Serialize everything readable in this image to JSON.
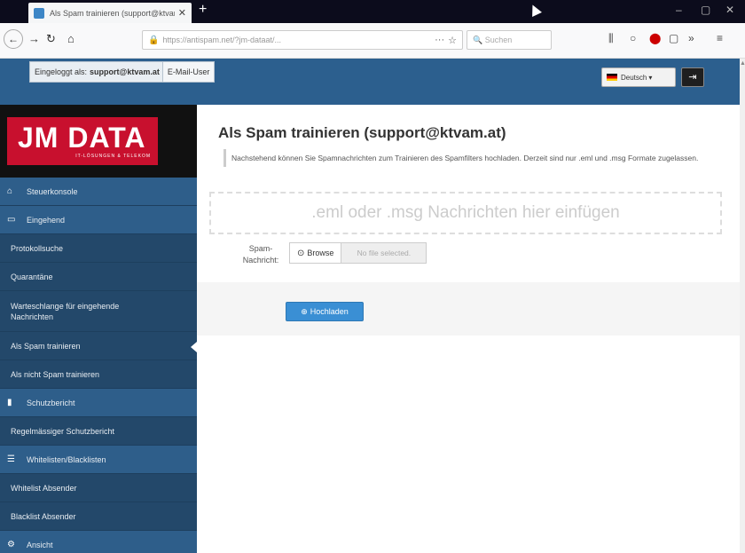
{
  "browser": {
    "tab_title": "Als Spam trainieren (support@ktvam.at)",
    "url": "https://antispam.net/?jm-dataat/...",
    "search_placeholder": "Suchen"
  },
  "header": {
    "login_label": "Eingeloggt als:",
    "login_user": "support@ktvam.at",
    "login_type": "E-Mail-User",
    "language": "Deutsch",
    "language_caret": "▾"
  },
  "logo": {
    "text": "JM DATA",
    "subtitle": "IT-LÖSUNGEN & TELEKOM"
  },
  "sidebar": {
    "items": [
      {
        "label": "Steuerkonsole",
        "icon": "home-icon"
      },
      {
        "label": "Eingehend",
        "icon": "inbox-icon"
      },
      {
        "label": "Protokollsuche"
      },
      {
        "label": "Quarantäne"
      },
      {
        "label": "Warteschlange für eingehende Nachrichten"
      },
      {
        "label": "Als Spam trainieren"
      },
      {
        "label": "Als nicht Spam trainieren"
      },
      {
        "label": "Schutzbericht",
        "icon": "file-icon"
      },
      {
        "label": "Regelmässiger Schutzbericht"
      },
      {
        "label": "Whitelisten/Blacklisten",
        "icon": "list-icon"
      },
      {
        "label": "Whitelist Absender"
      },
      {
        "label": "Blacklist Absender"
      },
      {
        "label": "Ansicht",
        "icon": "gear-icon"
      }
    ]
  },
  "main": {
    "title": "Als Spam trainieren (support@ktvam.at)",
    "info": "Nachstehend können Sie Spamnachrichten zum Trainieren des Spamfilters hochladen. Derzeit sind nur .eml und .msg Formate zugelassen.",
    "dropzone": ".eml oder .msg Nachrichten hier einfügen",
    "form_label": "Spam-Nachricht:",
    "browse": "Browse",
    "file_status": "No file selected.",
    "upload": "Hochladen"
  }
}
